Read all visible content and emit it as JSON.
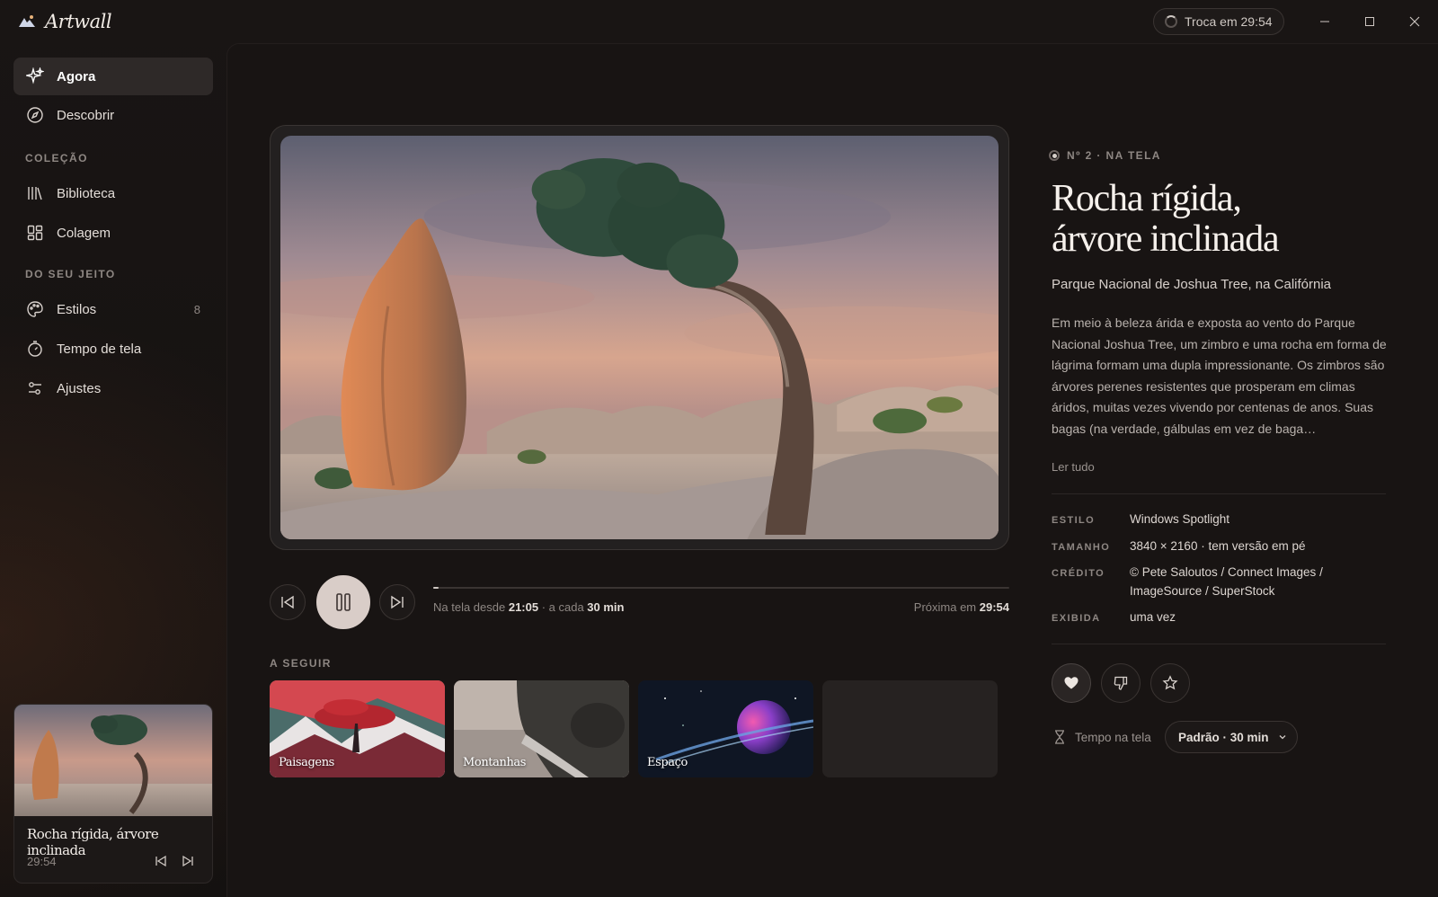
{
  "app": {
    "name": "Artwall"
  },
  "titlebar": {
    "timer_label": "Troca em 29:54"
  },
  "sidebar": {
    "primary": [
      {
        "label": "Agora",
        "icon": "sparkles-icon",
        "active": true
      },
      {
        "label": "Descobrir",
        "icon": "compass-icon"
      }
    ],
    "sections": [
      {
        "label": "COLEÇÃO",
        "items": [
          {
            "label": "Biblioteca",
            "icon": "library-icon"
          },
          {
            "label": "Colagem",
            "icon": "grid-icon"
          }
        ]
      },
      {
        "label": "DO SEU JEITO",
        "items": [
          {
            "label": "Estilos",
            "icon": "palette-icon",
            "count": "8"
          },
          {
            "label": "Tempo de tela",
            "icon": "stopwatch-icon"
          },
          {
            "label": "Ajustes",
            "icon": "sliders-icon"
          }
        ]
      }
    ],
    "mini_player": {
      "title": "Rocha rígida, árvore inclinada",
      "time": "29:54"
    }
  },
  "player": {
    "progress": 0.01,
    "since_prefix": "Na tela desde ",
    "since_time": "21:05",
    "interval_prefix": " · a cada ",
    "interval": "30 min",
    "next_prefix": "Próxima em ",
    "next_time": "29:54"
  },
  "up_next": {
    "label": "A SEGUIR",
    "items": [
      {
        "label": "Paisagens"
      },
      {
        "label": "Montanhas"
      },
      {
        "label": "Espaço"
      },
      {
        "label": ""
      }
    ]
  },
  "detail": {
    "now_label": "Nº 2 · NA TELA",
    "title_line1": "Rocha rígida,",
    "title_line2": "árvore inclinada",
    "subtitle": "Parque Nacional de Joshua Tree, na Califórnia",
    "description": "Em meio à beleza árida e exposta ao vento do Parque Nacional Joshua Tree, um zimbro e uma rocha em forma de lágrima formam uma dupla impressionante. Os zimbros são árvores perenes resistentes que prosperam em climas áridos, muitas vezes vivendo por centenas de anos. Suas bagas (na verdade, gálbulas em vez de baga…",
    "read_more": "Ler tudo",
    "meta": [
      {
        "key": "ESTILO",
        "value": "Windows Spotlight"
      },
      {
        "key": "TAMANHO",
        "value": "3840 × 2160 · tem versão em pé"
      },
      {
        "key": "CRÉDITO",
        "value": "© Pete Saloutos / Connect Images / ImageSource / SuperStock"
      },
      {
        "key": "EXIBIDA",
        "value": "uma vez"
      }
    ],
    "screen_time_label": "Tempo na tela",
    "screen_time_value": "Padrão · 30 min"
  }
}
